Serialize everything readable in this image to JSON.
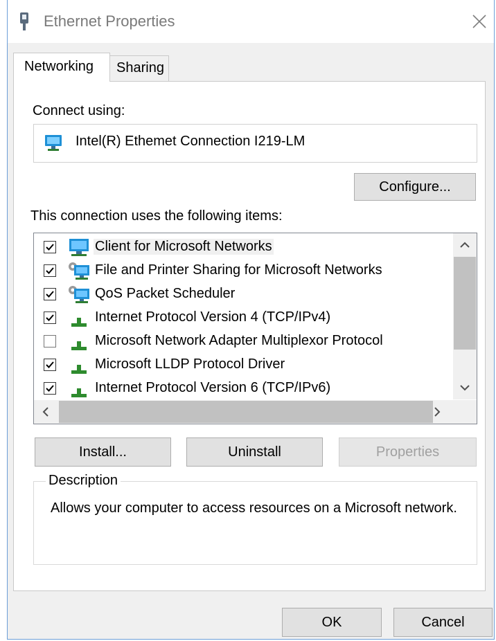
{
  "window": {
    "title": "Ethernet Properties",
    "title_icon": "network-adapter-icon",
    "close_icon": "close-icon"
  },
  "tabs": [
    {
      "label": "Networking",
      "active": true
    },
    {
      "label": "Sharing",
      "active": false
    }
  ],
  "connect_using": {
    "label": "Connect using:",
    "adapter": "Intel(R) Ethemet Connection I219-LM",
    "adapter_icon": "network-adapter-icon"
  },
  "configure_button": "Configure...",
  "items_label": "This connection uses the following items:",
  "items": [
    {
      "label": "Client for Microsoft Networks",
      "checked": true,
      "icon": "network-client-icon",
      "selected": true
    },
    {
      "label": "File and Printer Sharing for Microsoft Networks",
      "checked": true,
      "icon": "network-service-icon"
    },
    {
      "label": "QoS Packet Scheduler",
      "checked": true,
      "icon": "network-service-icon"
    },
    {
      "label": "Internet Protocol Version 4 (TCP/IPv4)",
      "checked": true,
      "icon": "protocol-icon"
    },
    {
      "label": "Microsoft Network Adapter Multiplexor Protocol",
      "checked": false,
      "icon": "protocol-icon"
    },
    {
      "label": "Microsoft LLDP Protocol Driver",
      "checked": true,
      "icon": "protocol-icon"
    },
    {
      "label": "Internet Protocol Version 6 (TCP/IPv6)",
      "checked": true,
      "icon": "protocol-icon"
    }
  ],
  "buttons": {
    "install": "Install...",
    "uninstall": "Uninstall",
    "properties": "Properties",
    "ok": "OK",
    "cancel": "Cancel"
  },
  "description": {
    "legend": "Description",
    "text": "Allows your computer to access resources on a Microsoft network."
  },
  "colors": {
    "accent_border": "#6b9ed8",
    "monitor_blue": "#1e90d6",
    "protocol_green": "#2e8b2e"
  }
}
